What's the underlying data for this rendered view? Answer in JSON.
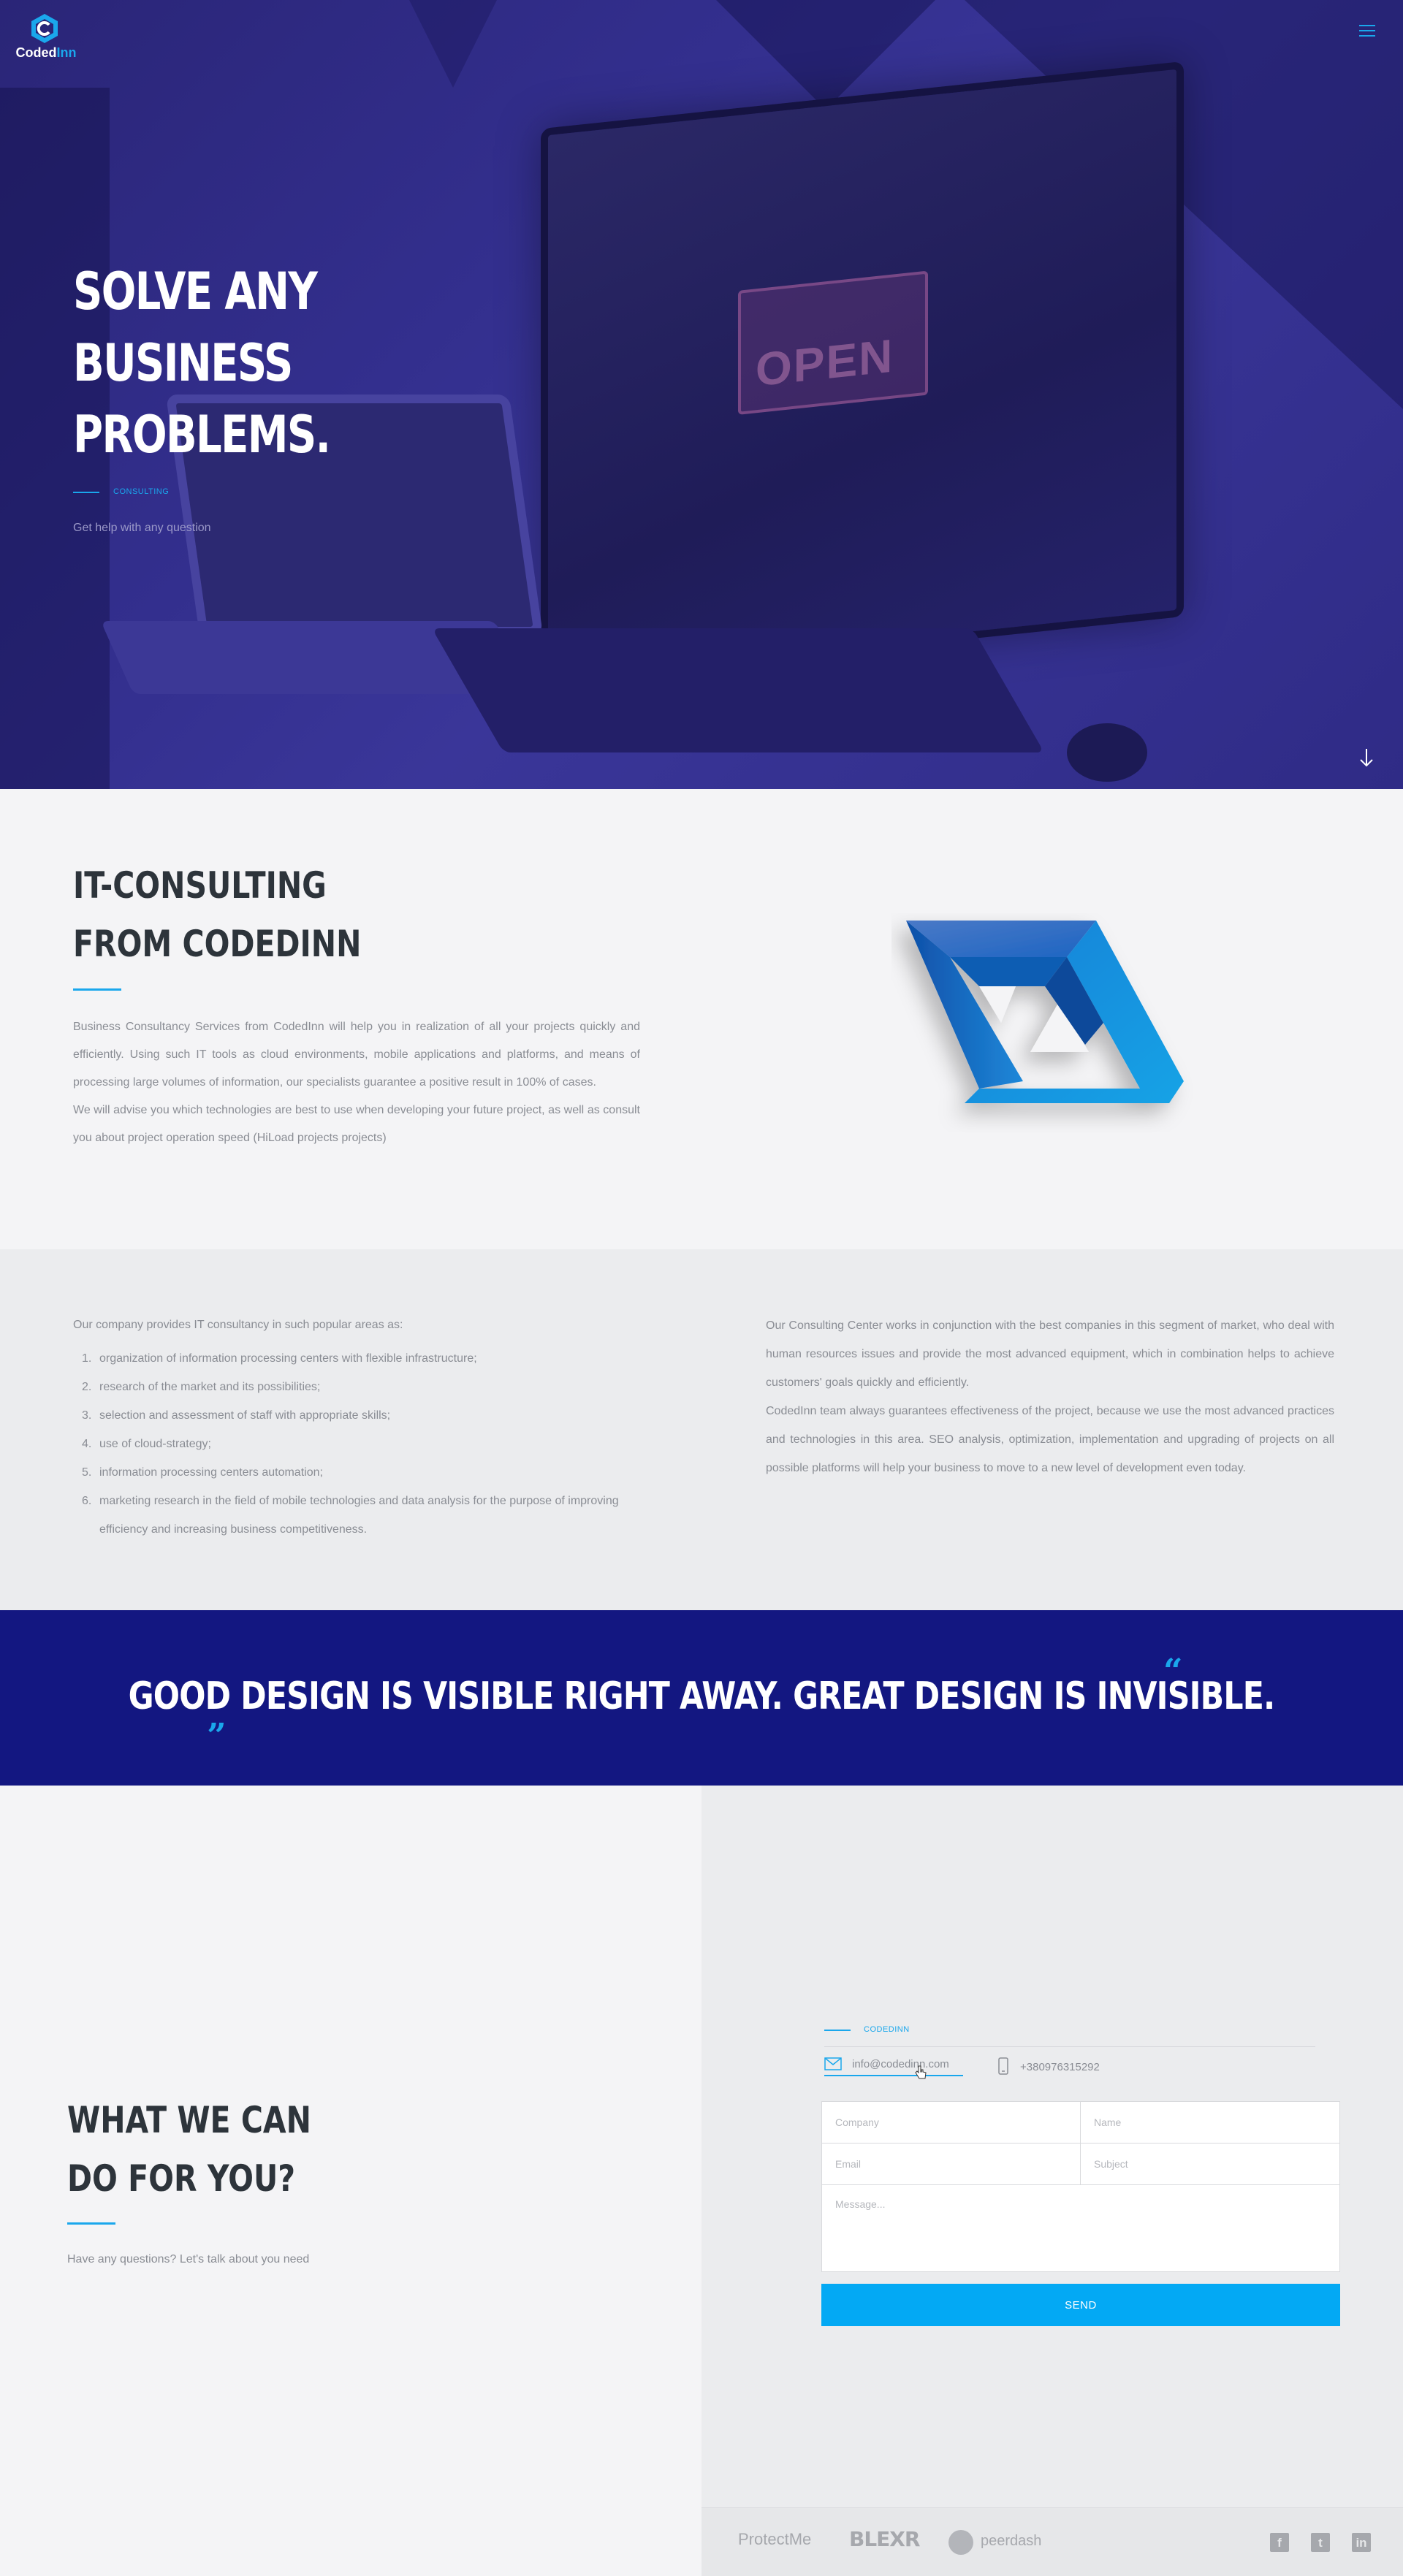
{
  "brand": {
    "name_part1": "Coded",
    "name_part2": "Inn"
  },
  "hero": {
    "title_line1": "SOLVE ANY",
    "title_line2": "BUSINESS",
    "title_line3": "PROBLEMS.",
    "kicker": "CONSULTING",
    "subtitle": "Get help with any question",
    "sign_text": "OPEN"
  },
  "about": {
    "title_line1": "IT-CONSULTING",
    "title_line2": "FROM CODEDINN",
    "paragraph1": "Business Consultancy Services from CodedInn will help you in realization of all your projects quickly and efficiently. Using such IT tools as cloud environments, mobile applications and platforms, and means of processing large volumes of information, our specialists guarantee a positive result in 100% of cases.",
    "paragraph2": "We will advise you which technologies are best to use when developing your future project, as well as consult you about project operation speed (HiLoad projects projects)"
  },
  "areas": {
    "intro": "Our company provides IT consultancy in such popular areas as:",
    "items": [
      {
        "num": "1.",
        "text": "organization of information processing centers with flexible infrastructure;"
      },
      {
        "num": "2.",
        "text": "research of the market and its possibilities;"
      },
      {
        "num": "3.",
        "text": "selection and assessment of staff with appropriate skills;"
      },
      {
        "num": "4.",
        "text": "use of cloud-strategy;"
      },
      {
        "num": "5.",
        "text": "information processing centers automation;"
      },
      {
        "num": "6.",
        "text": "marketing research in the field of mobile technologies and data analysis for the purpose of improving efficiency and increasing business competitiveness."
      }
    ],
    "right_paragraph1": "Our Consulting Center works in conjunction with the best companies in this segment of market, who deal with human resources issues and provide the most advanced equipment, which in combination helps to achieve customers' goals quickly and efficiently.",
    "right_paragraph2": "CodedInn team always guarantees effectiveness of the project, because we use the most advanced practices and technologies in this area. SEO analysis, optimization, implementation and upgrading of projects on all possible platforms will help your business to move to a new level of development even today."
  },
  "quote": {
    "open_mark": "„",
    "text": "GOOD DESIGN IS VISIBLE RIGHT AWAY. GREAT DESIGN IS INVISIBLE.",
    "close_mark": "“"
  },
  "contact": {
    "title_line1": "WHAT WE CAN",
    "title_line2": "DO FOR YOU?",
    "subtitle": "Have any questions? Let's talk about you need",
    "kicker": "CODEDINN",
    "email": "info@codedinn.com",
    "phone": "+380976315292",
    "form": {
      "company_placeholder": "Company",
      "name_placeholder": "Name",
      "email_placeholder": "Email",
      "subject_placeholder": "Subject",
      "message_placeholder": "Message...",
      "send_label": "SEND"
    }
  },
  "footer": {
    "partners": {
      "protect_a": "Protect",
      "protect_b": "Me",
      "blexr": "BLEXR",
      "peerdash": "peerdash"
    },
    "social": {
      "facebook": "f",
      "twitter": "t",
      "linkedin": "in"
    }
  },
  "colors": {
    "accent": "#1aa7ec",
    "hero_bg": "#332f8e",
    "quote_bg": "#131781",
    "send_button": "#03a9f4",
    "heading": "#2d343b"
  }
}
